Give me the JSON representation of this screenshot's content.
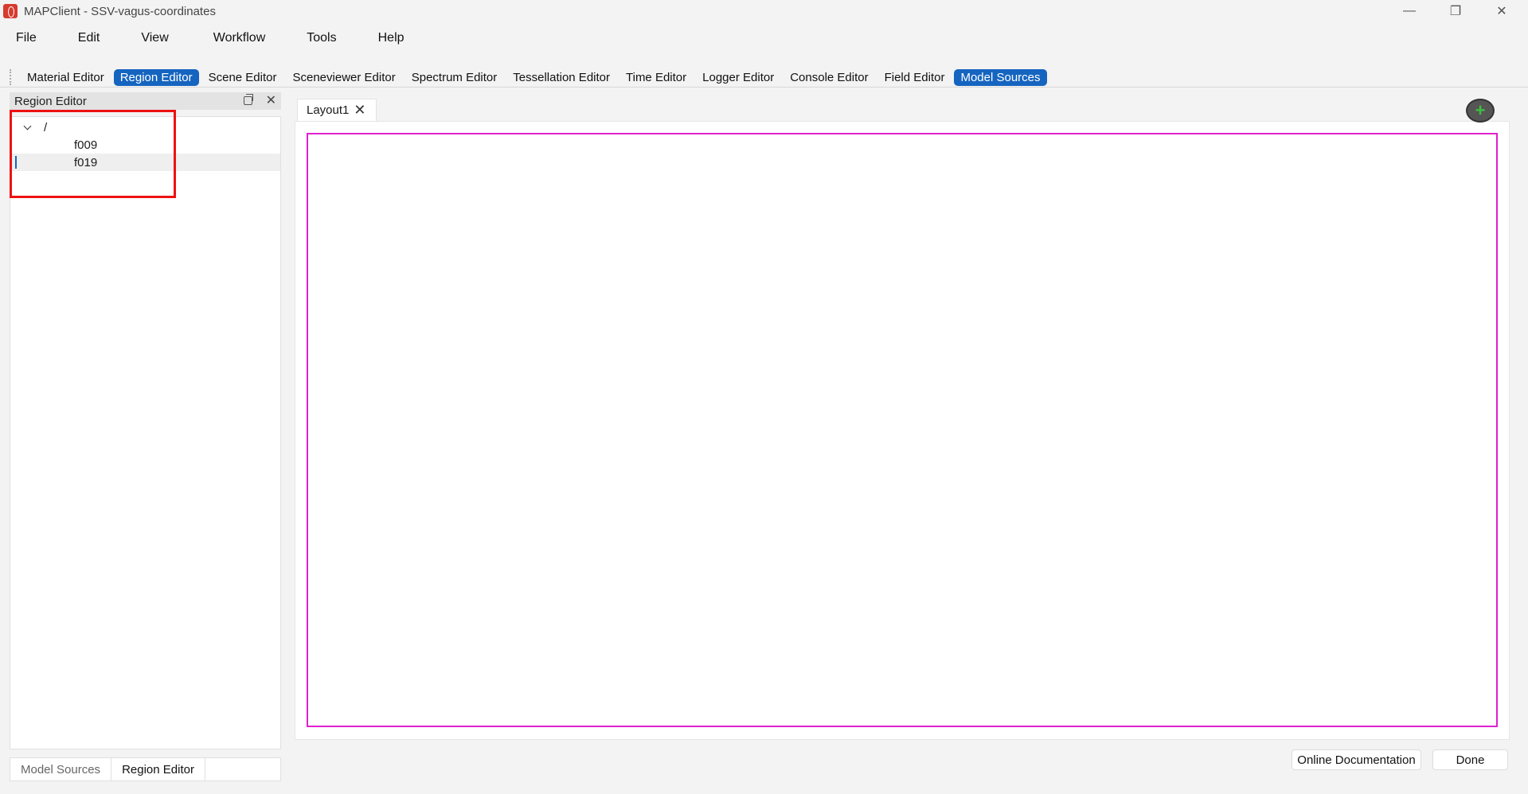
{
  "window": {
    "title": "MAPClient - SSV-vagus-coordinates",
    "minimize_glyph": "—",
    "restore_glyph": "❐",
    "close_glyph": "✕"
  },
  "menu": [
    "File",
    "Edit",
    "View",
    "Workflow",
    "Tools",
    "Help"
  ],
  "toolbar": {
    "buttons": [
      "Material Editor",
      "Region Editor",
      "Scene Editor",
      "Sceneviewer Editor",
      "Spectrum Editor",
      "Tessellation Editor",
      "Time Editor",
      "Logger Editor",
      "Console Editor",
      "Field Editor",
      "Model Sources"
    ],
    "active": [
      "Region Editor",
      "Model Sources"
    ]
  },
  "region_editor": {
    "title": "Region Editor",
    "close_glyph": "✕",
    "tree": {
      "root": "/",
      "children": [
        "f009",
        "f019"
      ],
      "selected": "f019"
    }
  },
  "bottom_tabs": [
    "Model Sources",
    "Region Editor"
  ],
  "layout_tab": {
    "label": "Layout1",
    "close_glyph": "✕"
  },
  "add_button_glyph": "+",
  "buttons": {
    "online_docs": "Online Documentation",
    "done": "Done"
  },
  "colors": {
    "accent": "#1565c0",
    "highlight": "#ee1111",
    "view_frame": "#e020d0",
    "add_plus": "#3fbf3f"
  },
  "icons": [
    "app-icon",
    "chevron-down-icon",
    "float-icon",
    "close-icon",
    "add-icon"
  ]
}
